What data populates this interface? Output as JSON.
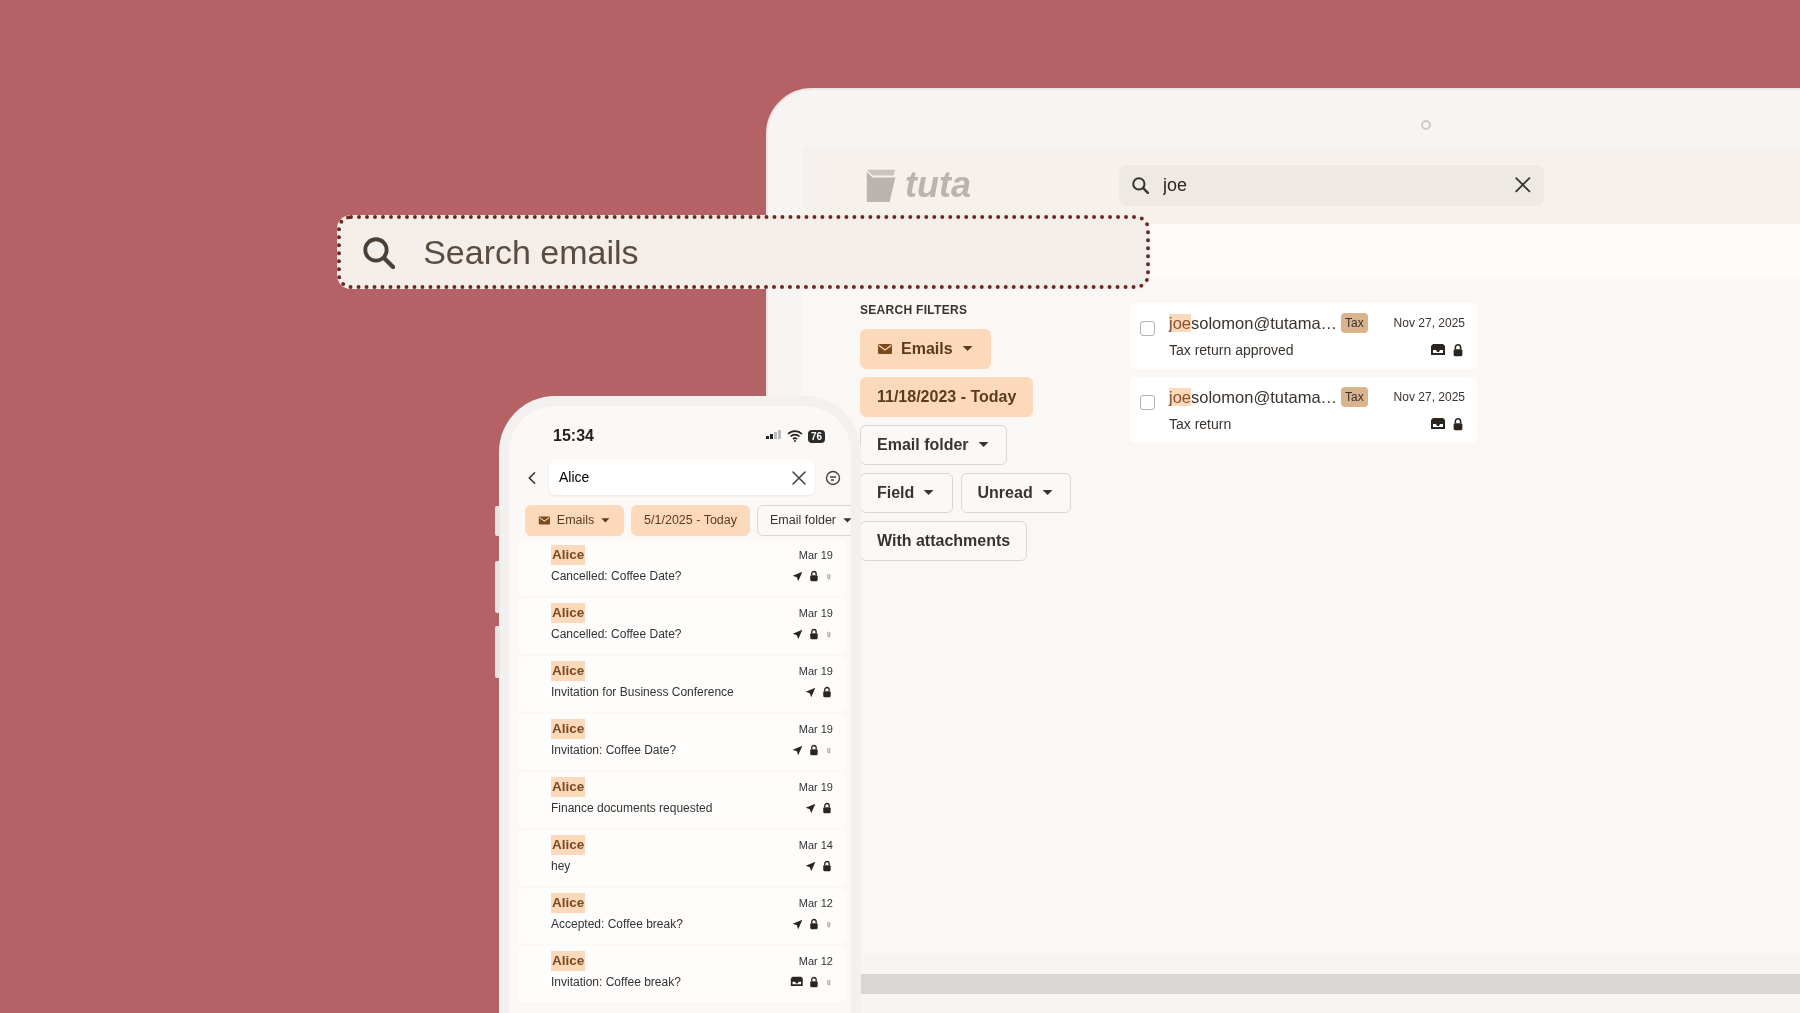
{
  "overlay_search": {
    "placeholder": "Search emails"
  },
  "laptop": {
    "logo": "tuta",
    "search": {
      "value": "joe"
    },
    "filters_title": "SEARCH FILTERS",
    "filters": [
      {
        "label": "Emails",
        "active": true,
        "dropdown": true
      },
      {
        "label": "11/18/2023 - Today",
        "active": true,
        "dropdown": false
      },
      {
        "label": "Email folder",
        "active": false,
        "dropdown": true
      },
      {
        "label": "Field",
        "active": false,
        "dropdown": true
      },
      {
        "label": "Unread",
        "active": false,
        "dropdown": true
      },
      {
        "label": "With attachments",
        "active": false,
        "dropdown": false
      }
    ],
    "results": [
      {
        "match": "joe",
        "rest": "solomon@tutama…",
        "tag": "Tax",
        "date": "Nov 27, 2025",
        "subject": "Tax return approved",
        "checked": false
      },
      {
        "match": "joe",
        "rest": "solomon@tutama…",
        "tag": "Tax",
        "date": "Nov 27, 2025",
        "subject": "Tax return",
        "checked": false
      }
    ]
  },
  "phone": {
    "time": "15:34",
    "battery": "76",
    "search": {
      "value": "Alice"
    },
    "filters": [
      {
        "label": "Emails",
        "active": true,
        "dropdown": true
      },
      {
        "label": "5/1/2025 - Today",
        "active": true,
        "dropdown": false
      },
      {
        "label": "Email folder",
        "active": false,
        "dropdown": true
      }
    ],
    "emails": [
      {
        "sender": "Alice",
        "date": "Mar 19",
        "subject": "Cancelled: Coffee Date?",
        "kind": "sent",
        "attachment": true
      },
      {
        "sender": "Alice",
        "date": "Mar 19",
        "subject": "Cancelled: Coffee Date?",
        "kind": "sent",
        "attachment": true
      },
      {
        "sender": "Alice",
        "date": "Mar 19",
        "subject": "Invitation for Business Conference",
        "kind": "sent",
        "attachment": false
      },
      {
        "sender": "Alice",
        "date": "Mar 19",
        "subject": "Invitation: Coffee Date?",
        "kind": "sent",
        "attachment": true
      },
      {
        "sender": "Alice",
        "date": "Mar 19",
        "subject": "Finance documents requested",
        "kind": "sent",
        "attachment": false
      },
      {
        "sender": "Alice",
        "date": "Mar 14",
        "subject": "hey",
        "kind": "sent",
        "attachment": false
      },
      {
        "sender": "Alice",
        "date": "Mar 12",
        "subject": "Accepted: Coffee break?",
        "kind": "sent",
        "attachment": true
      },
      {
        "sender": "Alice",
        "date": "Mar 12",
        "subject": "Invitation: Coffee break?",
        "kind": "received",
        "attachment": true
      }
    ]
  }
}
